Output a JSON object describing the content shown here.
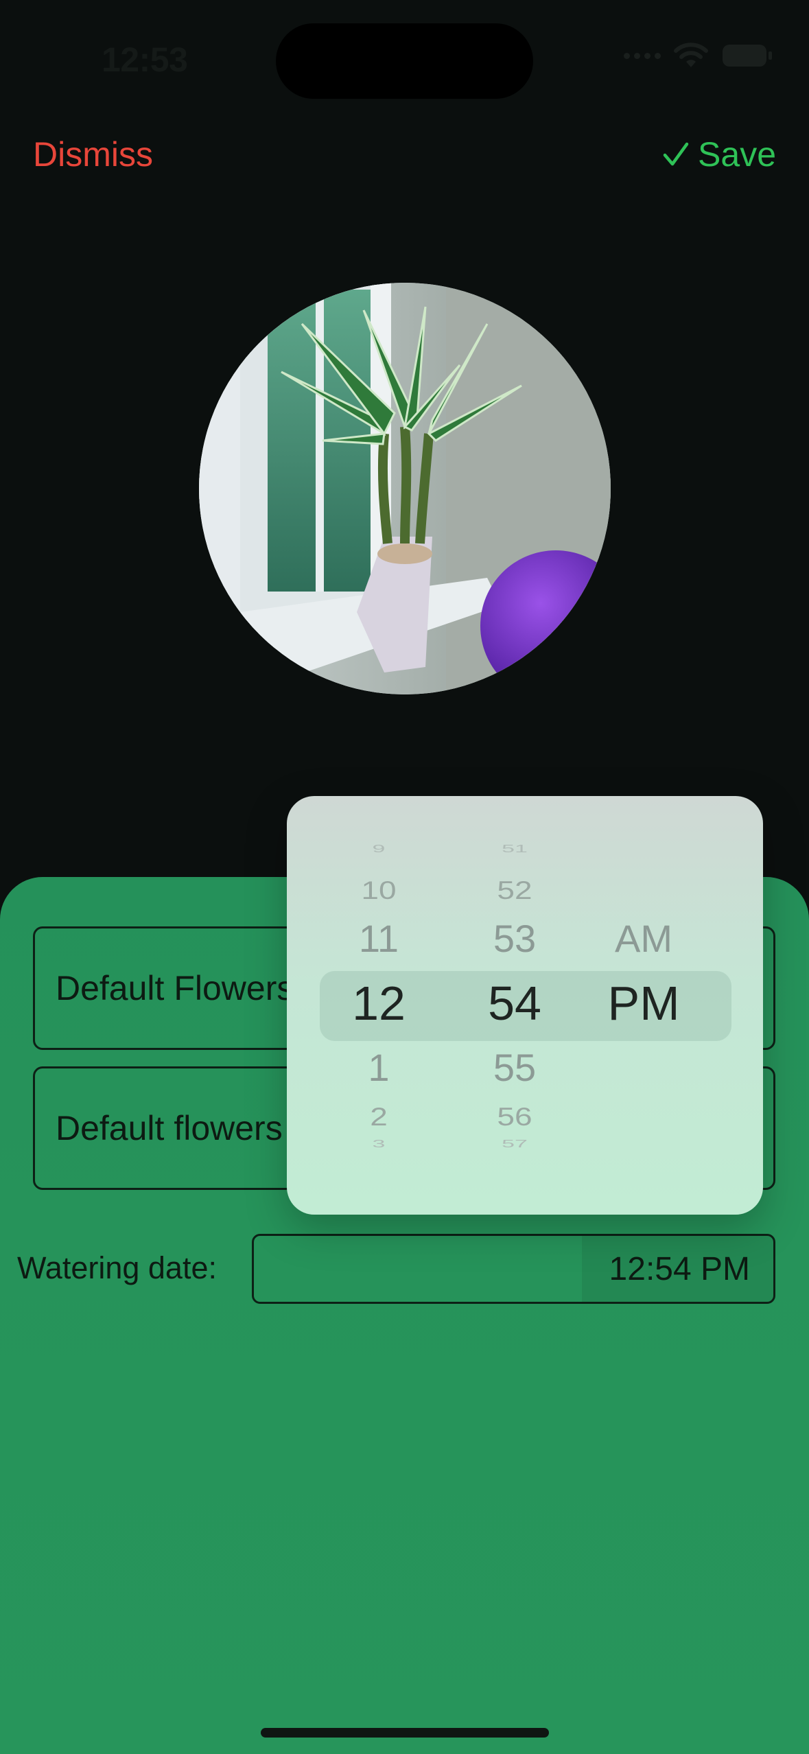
{
  "status_bar": {
    "time": "12:53"
  },
  "nav": {
    "dismiss_label": "Dismiss",
    "save_label": "Save"
  },
  "form": {
    "field_name_value": "Default Flowers",
    "field_description_value": "Default flowers",
    "watering_label": "Watering date:",
    "watering_time_value": "12:54 PM"
  },
  "time_picker": {
    "hours": [
      "9",
      "10",
      "11",
      "12",
      "1",
      "2",
      "3"
    ],
    "minutes": [
      "51",
      "52",
      "53",
      "54",
      "55",
      "56",
      "57"
    ],
    "periods": [
      "AM",
      "PM"
    ],
    "selected_hour": "12",
    "selected_minute": "54",
    "selected_period": "PM"
  },
  "colors": {
    "dismiss": "#e8463a",
    "save": "#2fc257",
    "sheet_green": "#26935a",
    "background": "#0b0f0e"
  }
}
